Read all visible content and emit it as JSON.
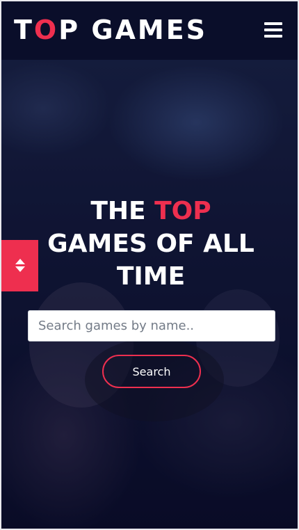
{
  "header": {
    "logo_prefix": "T",
    "logo_accent": "O",
    "logo_suffix": "P GAMES",
    "menu_icon": "hamburger-icon"
  },
  "hero": {
    "headline_line1_prefix": "THE ",
    "headline_line1_accent": "TOP",
    "headline_line2": "GAMES OF ALL",
    "headline_line3": "TIME"
  },
  "search": {
    "placeholder": "Search games by name..",
    "value": "",
    "button_label": "Search"
  },
  "side_toggle": {
    "icon": "up-down-arrows-icon"
  },
  "colors": {
    "accent": "#ee2f4f",
    "header_bg": "#0a0e2a",
    "text": "#ffffff"
  }
}
